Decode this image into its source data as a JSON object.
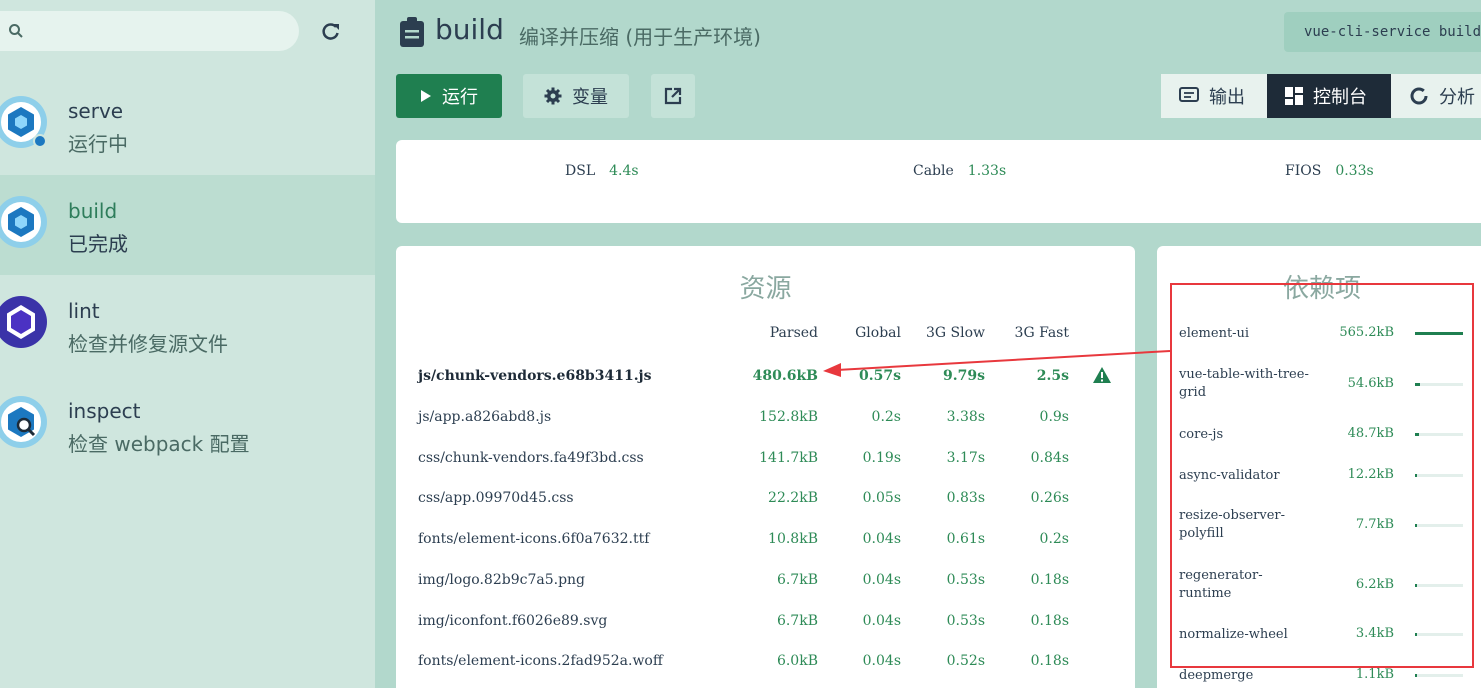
{
  "sidebar": {
    "search": {
      "value": "",
      "placeholder": ""
    },
    "tasks": [
      {
        "name": "serve",
        "status": "运行中"
      },
      {
        "name": "build",
        "status": "已完成"
      },
      {
        "name": "lint",
        "status": "检查并修复源文件"
      },
      {
        "name": "inspect",
        "status": "检查 webpack 配置"
      }
    ]
  },
  "header": {
    "title": "build",
    "description": "编译并压缩 (用于生产环境)",
    "command": "vue-cli-service build"
  },
  "toolbar": {
    "run_label": "运行",
    "vars_label": "变量",
    "output_label": "输出",
    "dashboard_label": "控制台",
    "analyze_label": "分析"
  },
  "speed": [
    {
      "label": "DSL",
      "value": "4.4s"
    },
    {
      "label": "Cable",
      "value": "1.33s"
    },
    {
      "label": "FIOS",
      "value": "0.33s"
    }
  ],
  "resources": {
    "title": "资源",
    "columns": [
      "Parsed",
      "Global",
      "3G Slow",
      "3G Fast"
    ],
    "rows": [
      {
        "name": "js/chunk-vendors.e68b3411.js",
        "parsed": "480.6kB",
        "global": "0.57s",
        "slow": "9.79s",
        "fast": "2.5s"
      },
      {
        "name": "js/app.a826abd8.js",
        "parsed": "152.8kB",
        "global": "0.2s",
        "slow": "3.38s",
        "fast": "0.9s"
      },
      {
        "name": "css/chunk-vendors.fa49f3bd.css",
        "parsed": "141.7kB",
        "global": "0.19s",
        "slow": "3.17s",
        "fast": "0.84s"
      },
      {
        "name": "css/app.09970d45.css",
        "parsed": "22.2kB",
        "global": "0.05s",
        "slow": "0.83s",
        "fast": "0.26s"
      },
      {
        "name": "fonts/element-icons.6f0a7632.ttf",
        "parsed": "10.8kB",
        "global": "0.04s",
        "slow": "0.61s",
        "fast": "0.2s"
      },
      {
        "name": "img/logo.82b9c7a5.png",
        "parsed": "6.7kB",
        "global": "0.04s",
        "slow": "0.53s",
        "fast": "0.18s"
      },
      {
        "name": "img/iconfont.f6026e89.svg",
        "parsed": "6.7kB",
        "global": "0.04s",
        "slow": "0.53s",
        "fast": "0.18s"
      },
      {
        "name": "fonts/element-icons.2fad952a.woff",
        "parsed": "6.0kB",
        "global": "0.04s",
        "slow": "0.52s",
        "fast": "0.18s"
      }
    ]
  },
  "dependencies": {
    "title": "依赖项",
    "items": [
      {
        "name": "element-ui",
        "size": "565.2kB",
        "ratio": 1.0
      },
      {
        "name": "vue-table-with-tree-grid",
        "size": "54.6kB",
        "ratio": 0.1
      },
      {
        "name": "core-js",
        "size": "48.7kB",
        "ratio": 0.09
      },
      {
        "name": "async-validator",
        "size": "12.2kB",
        "ratio": 0.02
      },
      {
        "name": "resize-observer-polyfill",
        "size": "7.7kB",
        "ratio": 0.014
      },
      {
        "name": "regenerator-runtime",
        "size": "6.2kB",
        "ratio": 0.011
      },
      {
        "name": "normalize-wheel",
        "size": "3.4kB",
        "ratio": 0.006
      },
      {
        "name": "deepmerge",
        "size": "1.1kB",
        "ratio": 0.002
      }
    ]
  },
  "colors": {
    "accent": "#1f7f50",
    "value_green": "#2e8b57",
    "annotation_red": "#e8383d",
    "warning": "#1f7f50"
  }
}
